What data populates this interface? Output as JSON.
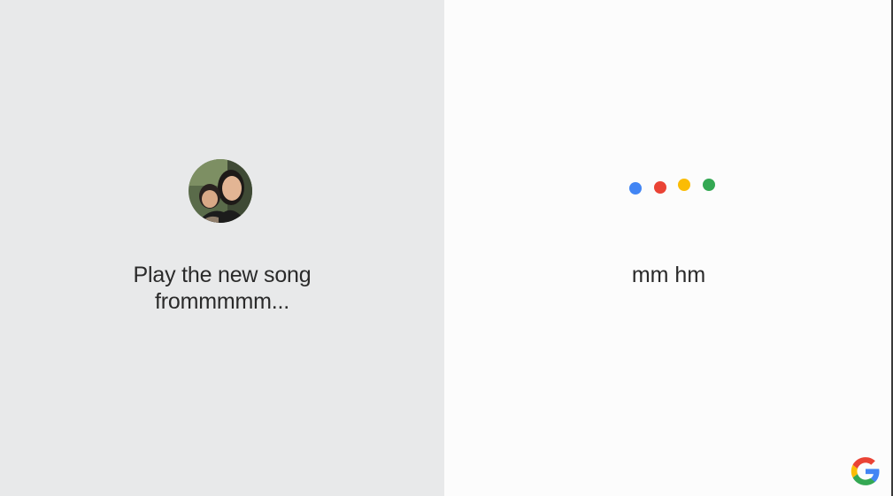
{
  "left_panel": {
    "user_query_line1": "Play the new song",
    "user_query_line2": "frommmmm..."
  },
  "right_panel": {
    "assistant_reply": "mm hm",
    "dots": [
      "#4285f4",
      "#ea4335",
      "#fbbc04",
      "#34a853"
    ]
  },
  "colors": {
    "left_background": "#e8e9ea",
    "right_background": "#fcfcfc",
    "text": "#2a2a2a"
  },
  "icons": {
    "avatar": "user-photo-avatar",
    "brand": "google-g-logo"
  }
}
